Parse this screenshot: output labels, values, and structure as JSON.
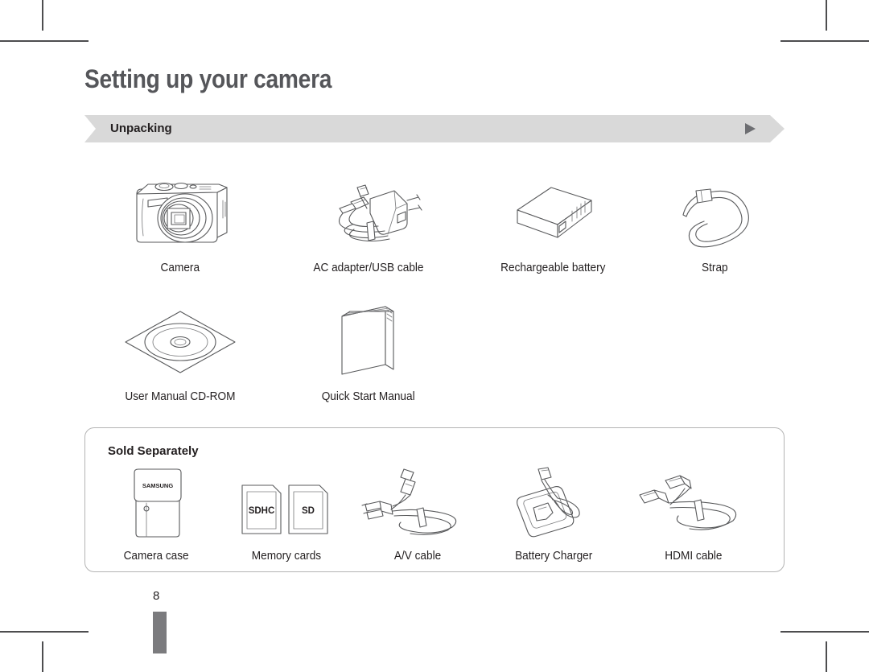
{
  "page": {
    "title": "Setting up your camera",
    "number": "8"
  },
  "banner": {
    "label": "Unpacking",
    "arrow_icon": "play-triangle-icon",
    "background_color": "#d9d9d9",
    "arrow_color": "#6d6e72"
  },
  "included_items": [
    {
      "icon": "camera-icon",
      "label": "Camera"
    },
    {
      "icon": "ac-adapter-icon",
      "label": "AC adapter/USB cable"
    },
    {
      "icon": "battery-icon",
      "label": "Rechargeable battery"
    },
    {
      "icon": "strap-icon",
      "label": "Strap"
    },
    {
      "icon": "cd-rom-icon",
      "label": "User Manual CD-ROM"
    },
    {
      "icon": "manual-book-icon",
      "label": "Quick Start Manual"
    }
  ],
  "sold_separately": {
    "title": "Sold Separately",
    "items": [
      {
        "icon": "camera-case-icon",
        "label": "Camera case"
      },
      {
        "icon": "memory-card-icon",
        "label": "Memory cards"
      },
      {
        "icon": "av-cable-icon",
        "label": "A/V cable"
      },
      {
        "icon": "battery-charger-icon",
        "label": "Battery Charger"
      },
      {
        "icon": "hdmi-cable-icon",
        "label": "HDMI cable"
      }
    ]
  },
  "labels": {
    "camera_case_brand": "SAMSUNG",
    "memory_card_sdhc": "SDHC",
    "memory_card_sd": "SD"
  }
}
